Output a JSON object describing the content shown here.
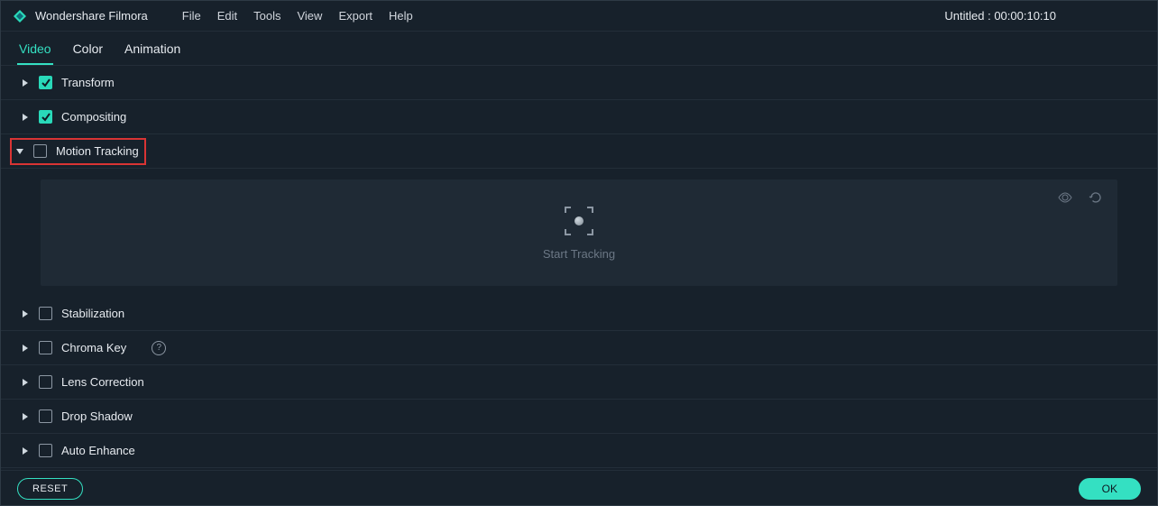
{
  "app": {
    "title": "Wondershare Filmora",
    "project_title": "Untitled : 00:00:10:10"
  },
  "menu": {
    "file": "File",
    "edit": "Edit",
    "tools": "Tools",
    "view": "View",
    "export": "Export",
    "help": "Help"
  },
  "tabs": {
    "video": "Video",
    "color": "Color",
    "animation": "Animation"
  },
  "sections": {
    "transform": "Transform",
    "compositing": "Compositing",
    "motion_tracking": "Motion Tracking",
    "stabilization": "Stabilization",
    "chroma_key": "Chroma Key",
    "lens_correction": "Lens Correction",
    "drop_shadow": "Drop Shadow",
    "auto_enhance": "Auto Enhance"
  },
  "tracking": {
    "start_label": "Start Tracking"
  },
  "footer": {
    "reset": "RESET",
    "ok": "OK"
  },
  "colors": {
    "accent": "#34e0c2",
    "highlight": "#d93434"
  }
}
